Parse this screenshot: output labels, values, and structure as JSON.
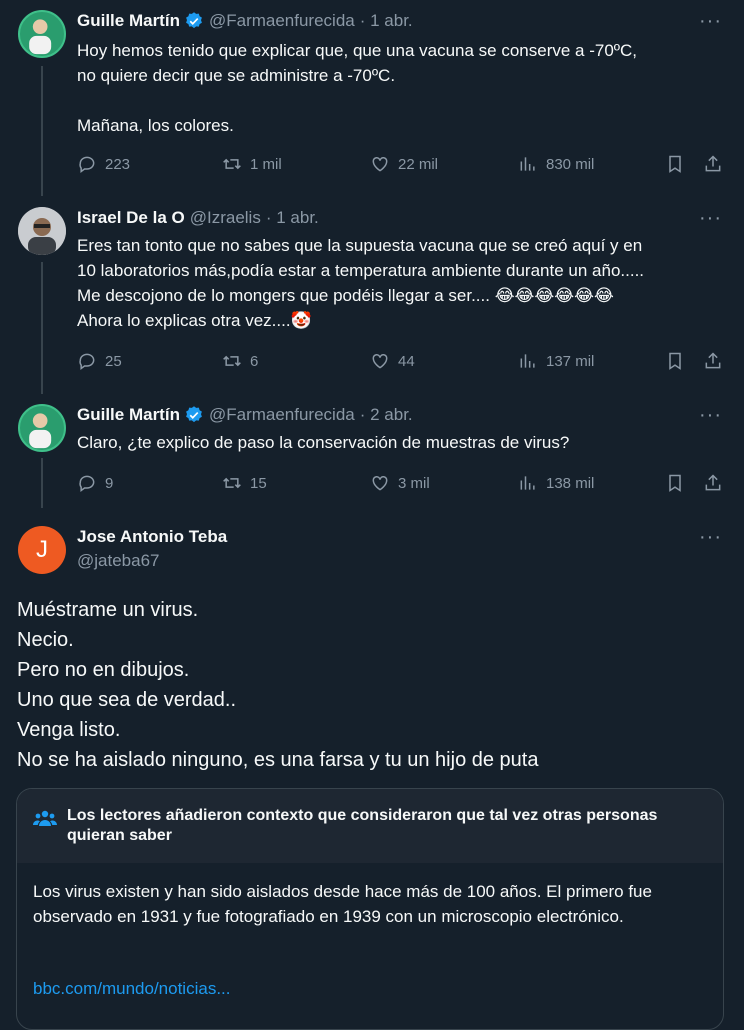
{
  "tweets": [
    {
      "name": "Guille Martín",
      "handle": "@Farmaenfurecida",
      "time": "· 1 abr.",
      "text": "Hoy hemos tenido que explicar que, que una vacuna se conserve a -70ºC,\nno quiere decir que se administre a -70ºC.\n\nMañana, los colores.",
      "replies": "223",
      "retweets": "1 mil",
      "likes": "22 mil",
      "views": "830 mil"
    },
    {
      "name": "Israel De la O",
      "handle": "@Izraelis",
      "time": "· 1 abr.",
      "text": "Eres tan tonto que no sabes que la supuesta vacuna que se creó aquí y en\n10 laboratorios más,podía estar a temperatura ambiente durante un año.....\nMe descojono de lo mongers que podéis llegar a ser.... 😂😂😂😂😂😂\nAhora lo explicas otra vez....🤡",
      "replies": "25",
      "retweets": "6",
      "likes": "44",
      "views": "137 mil"
    },
    {
      "name": "Guille Martín",
      "handle": "@Farmaenfurecida",
      "time": "· 2 abr.",
      "text": "Claro, ¿te explico de paso la conservación de muestras de virus?",
      "replies": "9",
      "retweets": "15",
      "likes": "3 mil",
      "views": "138 mil"
    }
  ],
  "main": {
    "avatar_letter": "J",
    "name": "Jose Antonio Teba",
    "handle": "@jateba67",
    "text": "Muéstrame un virus.\nNecio.\nPero no en dibujos.\nUno que sea de verdad..\nVenga listo.\nNo se ha aislado ninguno, es una farsa y tu un hijo de puta"
  },
  "note": {
    "title": "Los lectores añadieron contexto que consideraron que tal vez otras personas quieran saber",
    "body": "Los virus existen y han sido aislados desde hace más de 100 años. El primero fue observado en 1931 y fue fotografiado en 1939 con un microscopio electrónico.",
    "link": "bbc.com/mundo/noticias..."
  },
  "more_label": "···",
  "colors": {
    "bg": "#15202b",
    "accent": "#1d9bf0",
    "muted": "#8b98a5"
  }
}
